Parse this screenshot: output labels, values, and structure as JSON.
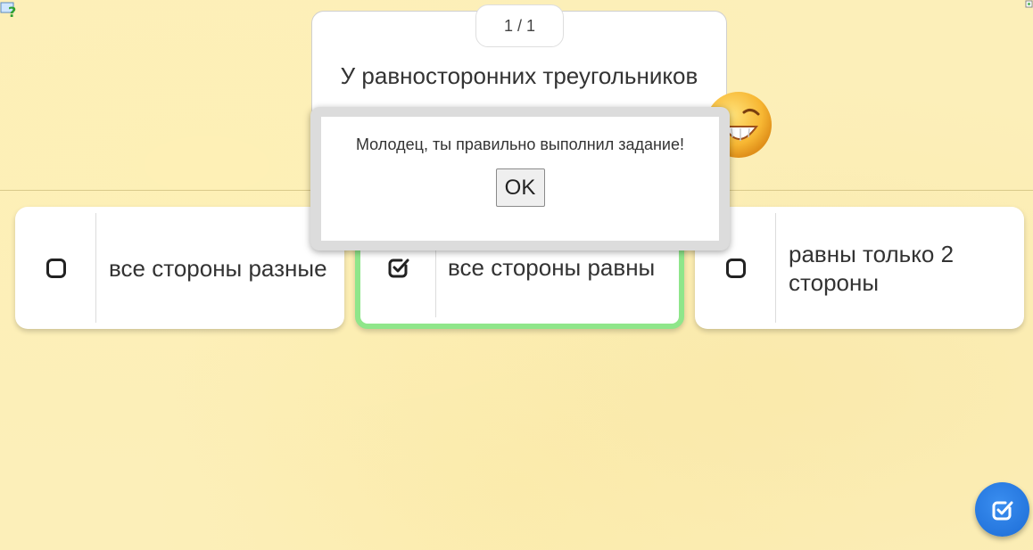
{
  "question": {
    "counter": "1 / 1",
    "text": "У равносторонних треугольников"
  },
  "answers": [
    {
      "label": "все стороны разные",
      "checked": false
    },
    {
      "label": "все стороны равны",
      "checked": true
    },
    {
      "label": "равны только 2 стороны",
      "checked": false
    }
  ],
  "dialog": {
    "message": "Молодец, ты правильно выполнил задание!",
    "ok_label": "OK"
  },
  "icons": {
    "help": "help-icon",
    "emoji": "grin-emoji-icon",
    "checkbox_empty": "checkbox-empty-icon",
    "checkbox_checked": "checkbox-checked-icon",
    "submit": "submit-check-icon"
  },
  "colors": {
    "background": "#fcefb9",
    "correct_border": "#8fe68a",
    "submit_button": "#2a7de6"
  }
}
